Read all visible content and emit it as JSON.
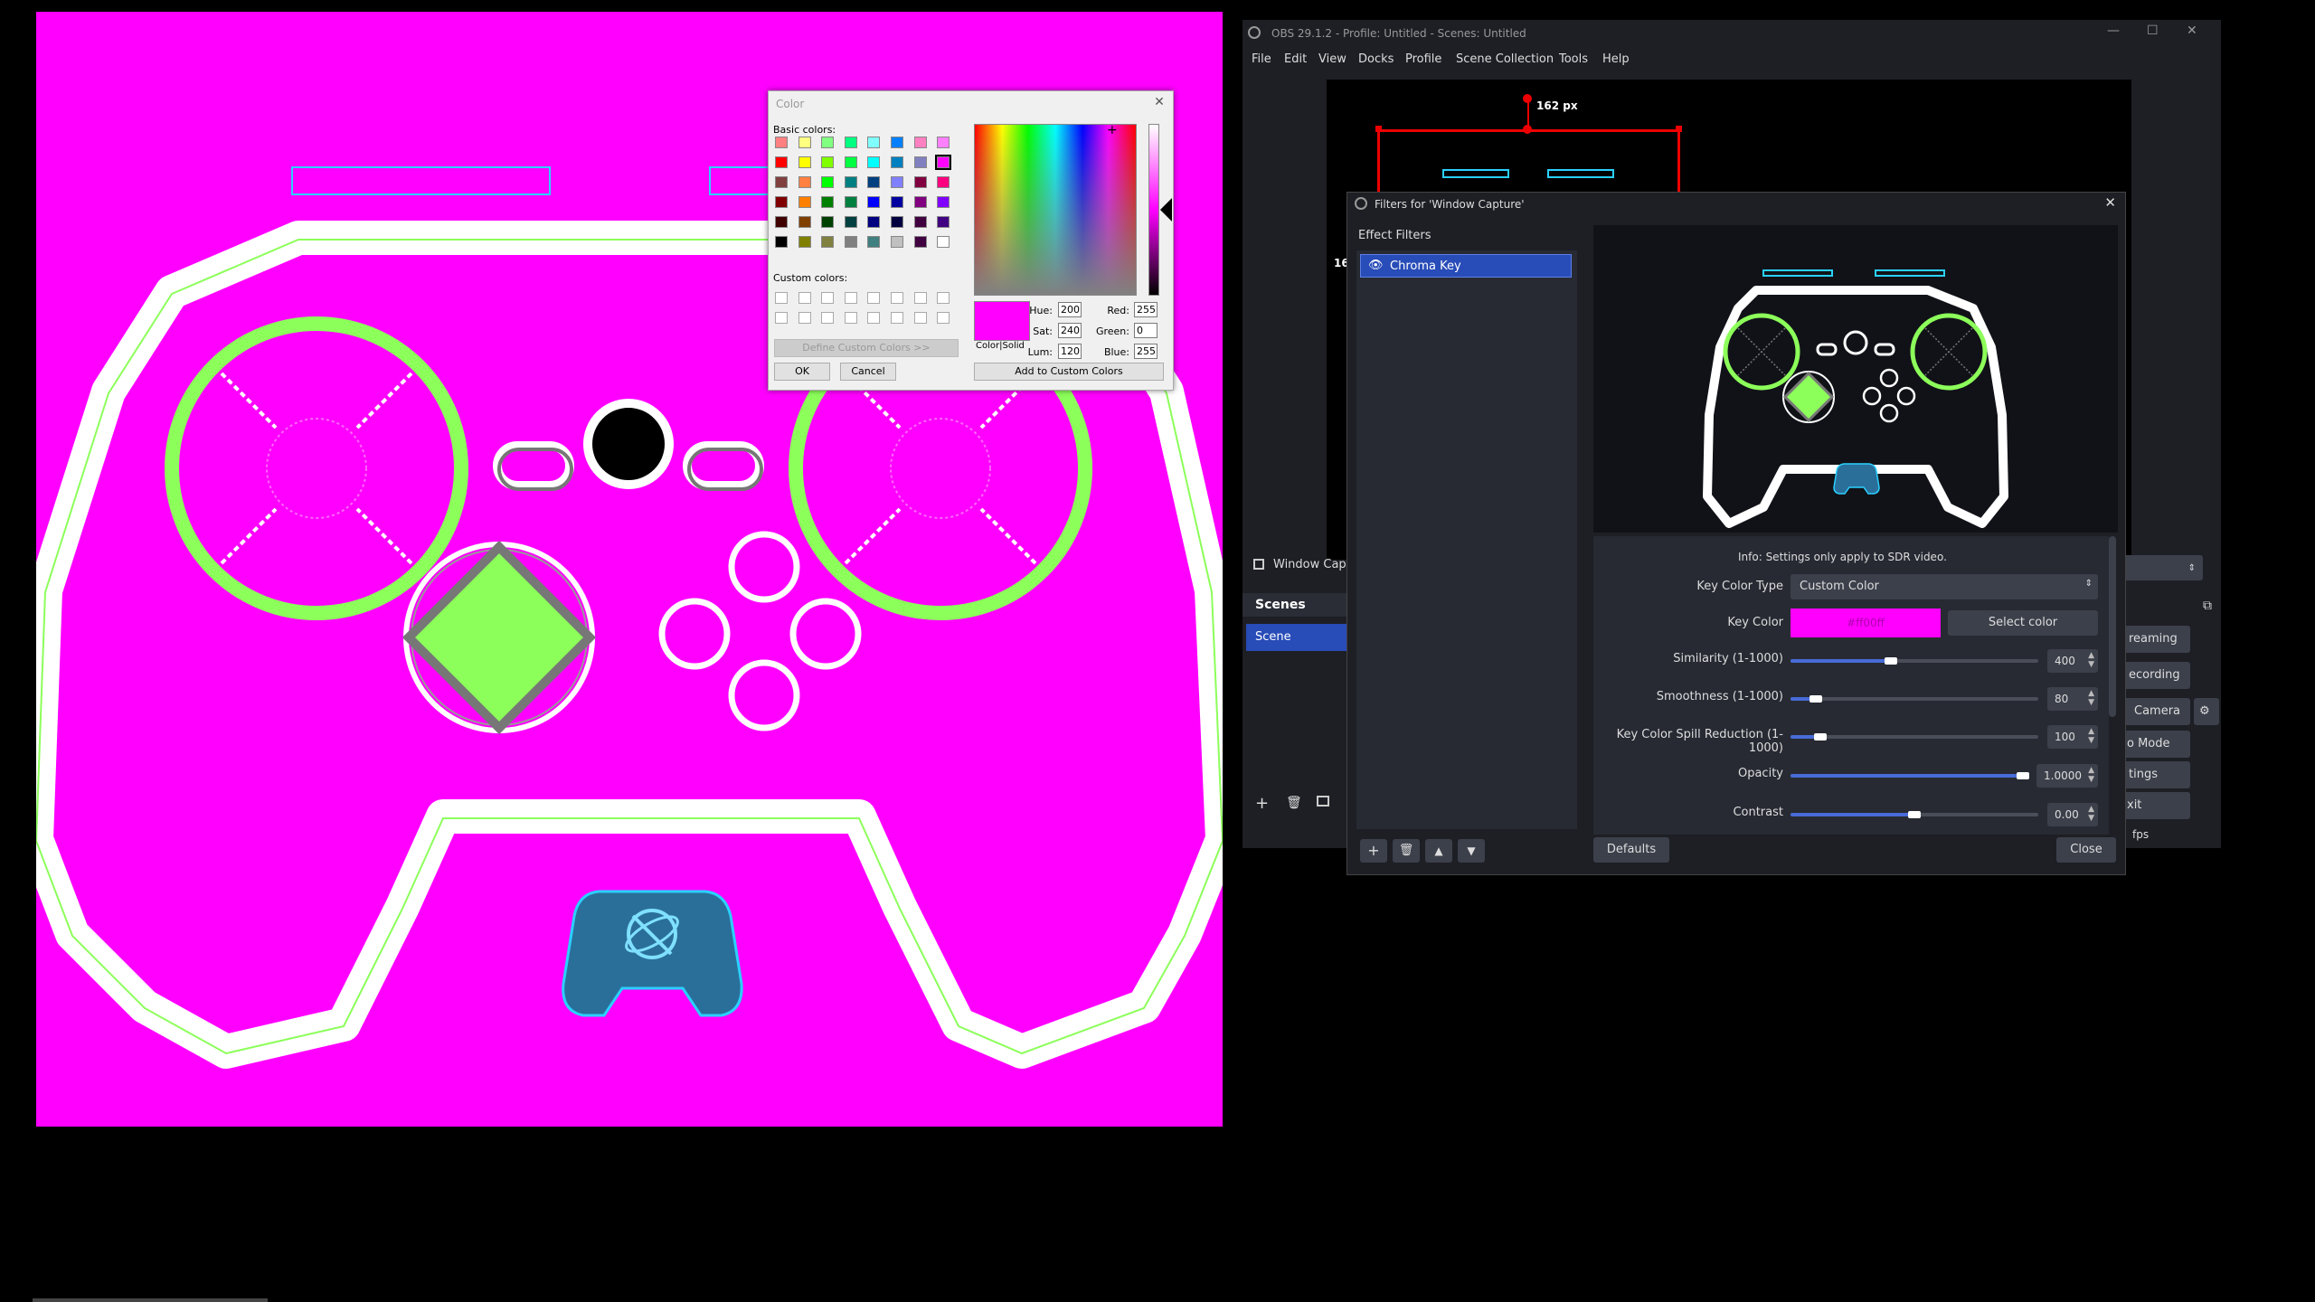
{
  "colors": {
    "magenta": "#ff00ff",
    "green": "#8cff5a",
    "white": "#ffffff",
    "obs_bg": "#1e1f25",
    "accent_blue": "#284cb8"
  },
  "color_dialog": {
    "title": "Color",
    "basic_colors_label": "Basic colors:",
    "custom_colors_label": "Custom colors:",
    "define_custom_button": "Define Custom Colors >>",
    "ok_button": "OK",
    "cancel_button": "Cancel",
    "add_custom_button": "Add to Custom Colors",
    "color_solid_label": "Color|Solid",
    "selected_color": "#ff00ff",
    "fields": {
      "hue_label": "Hue:",
      "hue": "200",
      "sat_label": "Sat:",
      "sat": "240",
      "lum_label": "Lum:",
      "lum": "120",
      "red_label": "Red:",
      "red": "255",
      "green_label": "Green:",
      "green": "0",
      "blue_label": "Blue:",
      "blue": "255"
    },
    "basic_palette": [
      [
        "#ff8080",
        "#ffff80",
        "#80ff80",
        "#00ff80",
        "#80ffff",
        "#0080ff",
        "#ff80c0",
        "#ff80ff"
      ],
      [
        "#ff0000",
        "#ffff00",
        "#80ff00",
        "#00ff40",
        "#00ffff",
        "#0080c0",
        "#8080c0",
        "#ff00ff"
      ],
      [
        "#804040",
        "#ff8040",
        "#00ff00",
        "#008080",
        "#004080",
        "#8080ff",
        "#800040",
        "#ff0080"
      ],
      [
        "#800000",
        "#ff8000",
        "#008000",
        "#008040",
        "#0000ff",
        "#0000a0",
        "#800080",
        "#8000ff"
      ],
      [
        "#400000",
        "#804000",
        "#004000",
        "#004040",
        "#000080",
        "#000040",
        "#400040",
        "#400080"
      ],
      [
        "#000000",
        "#808000",
        "#808040",
        "#808080",
        "#408080",
        "#c0c0c0",
        "#400040",
        "#ffffff"
      ]
    ]
  },
  "obs": {
    "title": "OBS 29.1.2 - Profile: Untitled - Scenes: Untitled",
    "menu": [
      "File",
      "Edit",
      "View",
      "Docks",
      "Profile",
      "Scene Collection",
      "Tools",
      "Help"
    ],
    "preview_measure": "162 px",
    "preview_measure_left": "16",
    "source_label": "Window Capt",
    "scenes_header": "Scenes",
    "scene_item": "Scene",
    "controls": [
      "reaming",
      "ecording",
      "Camera",
      "o Mode",
      "tings",
      "xit"
    ],
    "fps": "fps"
  },
  "filters": {
    "title": "Filters for 'Window Capture'",
    "effect_filters_label": "Effect Filters",
    "filter_item": "Chroma Key",
    "info": "Info: Settings only apply to SDR video.",
    "key_color_type_label": "Key Color Type",
    "key_color_type_value": "Custom Color",
    "key_color_label": "Key Color",
    "key_color_value": "#ff00ff",
    "select_color_button": "Select color",
    "similarity_label": "Similarity (1-1000)",
    "similarity": "400",
    "similarity_level": 0.4,
    "smoothness_label": "Smoothness (1-1000)",
    "smoothness": "80",
    "smoothness_level": 0.08,
    "spill_label": "Key Color Spill Reduction (1-1000)",
    "spill": "100",
    "spill_level": 0.1,
    "opacity_label": "Opacity",
    "opacity": "1.0000",
    "opacity_level": 1.0,
    "contrast_label": "Contrast",
    "contrast": "0.00",
    "contrast_level": 0.5,
    "defaults_button": "Defaults",
    "close_button": "Close"
  }
}
